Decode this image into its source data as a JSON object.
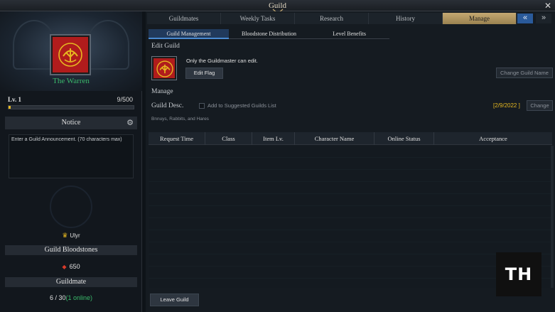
{
  "window": {
    "title": "Guild",
    "close_glyph": "✕"
  },
  "sidebar": {
    "guild_name": "The Warren",
    "level_label": "Lv. 1",
    "exp_text": "9/500",
    "exp_fraction": 0.018,
    "notice_title": "Notice",
    "notice_placeholder": "Enter a Guild Announcement. (70 characters max)",
    "leader_name": "Ulyr",
    "bloodstones_title": "Guild Bloodstones",
    "bloodstones_value": "650",
    "guildmate_title": "Guildmate",
    "guildmate_count": "6 / 30",
    "guildmate_online": "(1 online)"
  },
  "tabs": [
    {
      "label": "Guildmates",
      "active": false
    },
    {
      "label": "Weekly Tasks",
      "active": false
    },
    {
      "label": "Research",
      "active": false
    },
    {
      "label": "History",
      "active": false
    },
    {
      "label": "Manage",
      "active": true
    }
  ],
  "nav": {
    "prev_glyph": "«",
    "next_glyph": "»"
  },
  "subtabs": [
    {
      "label": "Guild Management",
      "active": true
    },
    {
      "label": "Bloodstone Distribution",
      "active": false
    },
    {
      "label": "Level Benefits",
      "active": false
    }
  ],
  "edit_guild": {
    "title": "Edit Guild",
    "note": "Only the Guildmaster can edit.",
    "edit_flag_label": "Edit Flag",
    "change_name_label": "Change Guild Name"
  },
  "manage": {
    "title": "Manage",
    "desc_label": "Guild Desc.",
    "suggested_label": "Add to Suggested Guilds List",
    "date": "[2/9/2022 ]",
    "change_label": "Change",
    "desc_text": "Bnnuys, Rabbits, and Hares"
  },
  "table": {
    "columns": [
      "Request Time",
      "Class",
      "Item Lv.",
      "Character Name",
      "Online Status",
      "Acceptance"
    ]
  },
  "footer": {
    "leave_label": "Leave Guild"
  },
  "watermark": "TH",
  "colors": {
    "accent_gold": "#e6b820",
    "guild_green": "#3ab86a",
    "flag_red": "#b01c1c",
    "active_blue": "#2a5a9a"
  },
  "icons": [
    "close-icon",
    "gear-icon",
    "crown-icon",
    "bloodstone-icon",
    "guild-flag-emblem"
  ]
}
